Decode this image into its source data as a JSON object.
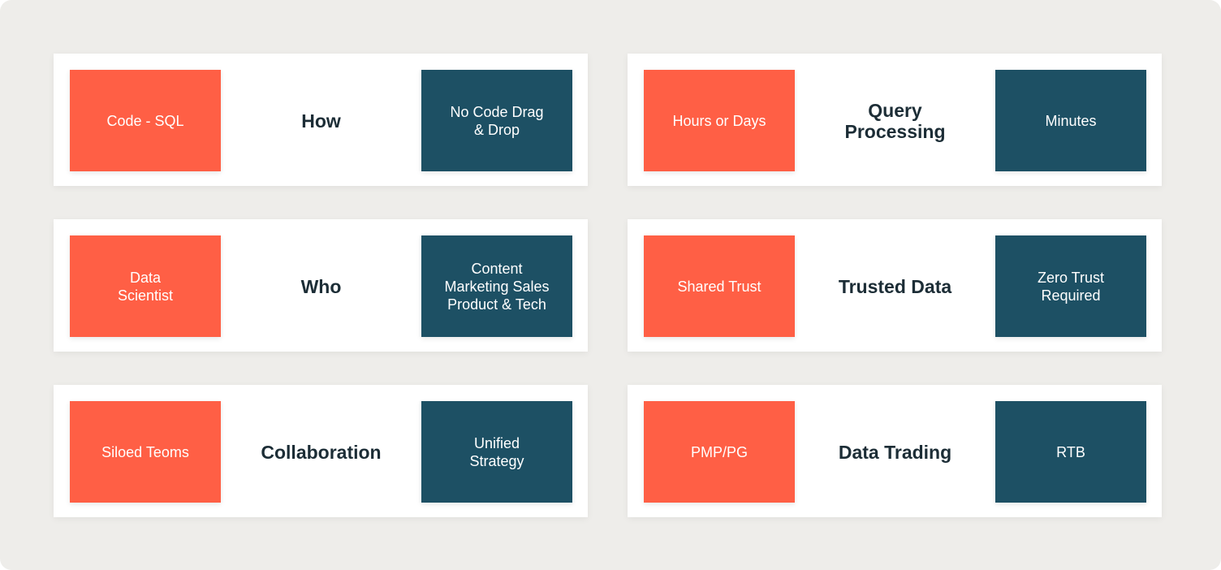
{
  "colors": {
    "background": "#eeedea",
    "card": "#ffffff",
    "old_way": "#ff5f45",
    "new_way": "#1d5064",
    "label": "#1c2d36"
  },
  "comparisons": [
    {
      "category": "How",
      "left": "Code - SQL",
      "right": "No Code Drag\n& Drop"
    },
    {
      "category": "Query\nProcessing",
      "left": "Hours or Days",
      "right": "Minutes"
    },
    {
      "category": "Who",
      "left": "Data\nScientist",
      "right": "Content\nMarketing Sales\nProduct & Tech"
    },
    {
      "category": "Trusted Data",
      "left": "Shared Trust",
      "right": "Zero Trust\nRequired"
    },
    {
      "category": "Collaboration",
      "left": "Siloed Teoms",
      "right": "Unified\nStrategy"
    },
    {
      "category": "Data Trading",
      "left": "PMP/PG",
      "right": "RTB"
    }
  ]
}
